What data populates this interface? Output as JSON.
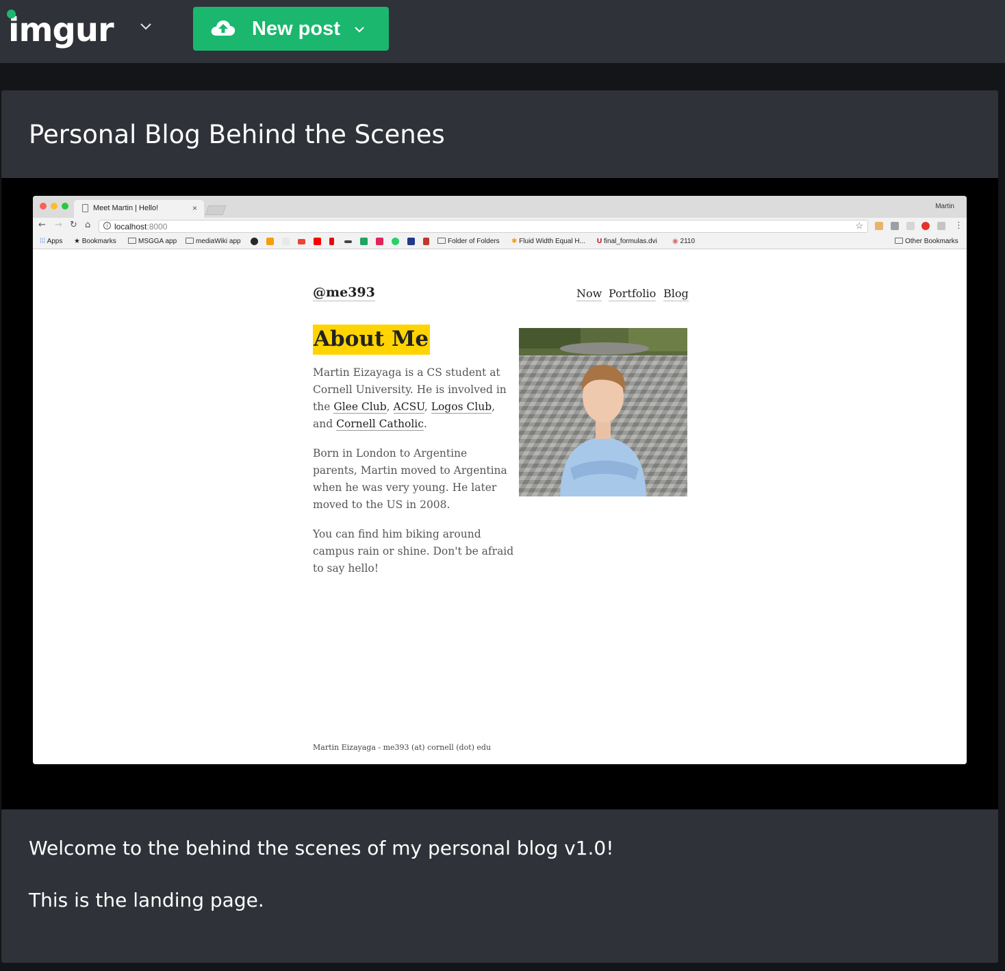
{
  "imgur": {
    "logo_text": "imgur",
    "new_post_label": "New post",
    "accent_color": "#1bb76e"
  },
  "post": {
    "title": "Personal Blog Behind the Scenes",
    "description": [
      "Welcome to the behind the scenes of my personal blog v1.0!",
      "This is the landing page."
    ]
  },
  "browser": {
    "tab_title": "Meet Martin | Hello!",
    "tab_close": "×",
    "profile_name": "Martin",
    "url_host": "localhost",
    "url_port": ":8000",
    "bookmarks": {
      "apps": "Apps",
      "bookmarks": "Bookmarks",
      "msgga": "MSGGA app",
      "mediawiki": "mediaWiki app",
      "folder_of_folders": "Folder of Folders",
      "fluid_width": "Fluid Width Equal H...",
      "final_formulas": "final_formulas.dvi",
      "count_2110": "2110",
      "other": "Other Bookmarks"
    }
  },
  "site": {
    "handle": "@me393",
    "nav": [
      "Now",
      "Portfolio",
      "Blog"
    ],
    "heading": "About Me",
    "p1": {
      "intro": "Martin Eizayaga is a CS student at Cornell University. He is involved in the ",
      "link1": "Glee Club",
      "sep1": ", ",
      "link2": "ACSU",
      "sep2": ", ",
      "link3": "Logos Club",
      "sep3": ", and ",
      "link4": "Cornell Catholic",
      "end": "."
    },
    "p2": "Born in London to Argentine parents, Martin moved to Argentina when he was very young. He later moved to the US in 2008.",
    "p3": "You can find him biking around campus rain or shine. Don't be afraid to say hello!",
    "footer": "Martin Eizayaga - me393 (at) cornell (dot) edu",
    "highlight_color": "#ffd400"
  }
}
